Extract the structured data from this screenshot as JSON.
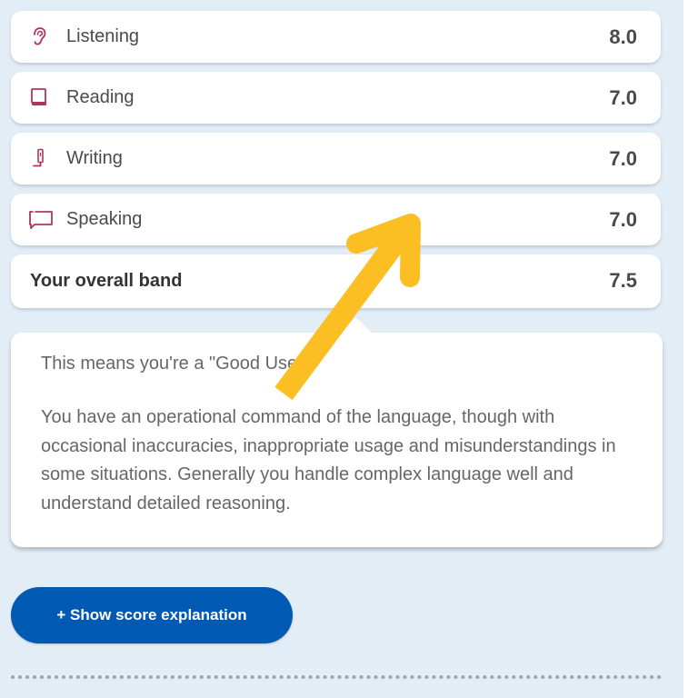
{
  "scores": [
    {
      "icon": "ear-icon",
      "label": "Listening",
      "value": "8.0"
    },
    {
      "icon": "book-icon",
      "label": "Reading",
      "value": "7.0"
    },
    {
      "icon": "pencil-icon",
      "label": "Writing",
      "value": "7.0"
    },
    {
      "icon": "speech-bubble-icon",
      "label": "Speaking",
      "value": "7.0"
    }
  ],
  "overall": {
    "label": "Your overall band",
    "value": "7.5"
  },
  "description": {
    "headline": "This means you're a \"Good User\"",
    "body": "You have an operational command of the language, though with occasional inaccuracies, inappropriate usage and misunderstandings in some situations. Generally you handle complex language well and understand detailed reasoning."
  },
  "show_explanation_button": {
    "label": "+ Show score explanation"
  },
  "colors": {
    "icon_accent": "#b0345e",
    "button_blue": "#0059b3",
    "annotation_arrow": "#fbbf24",
    "panel_background": "#e3edf6"
  }
}
